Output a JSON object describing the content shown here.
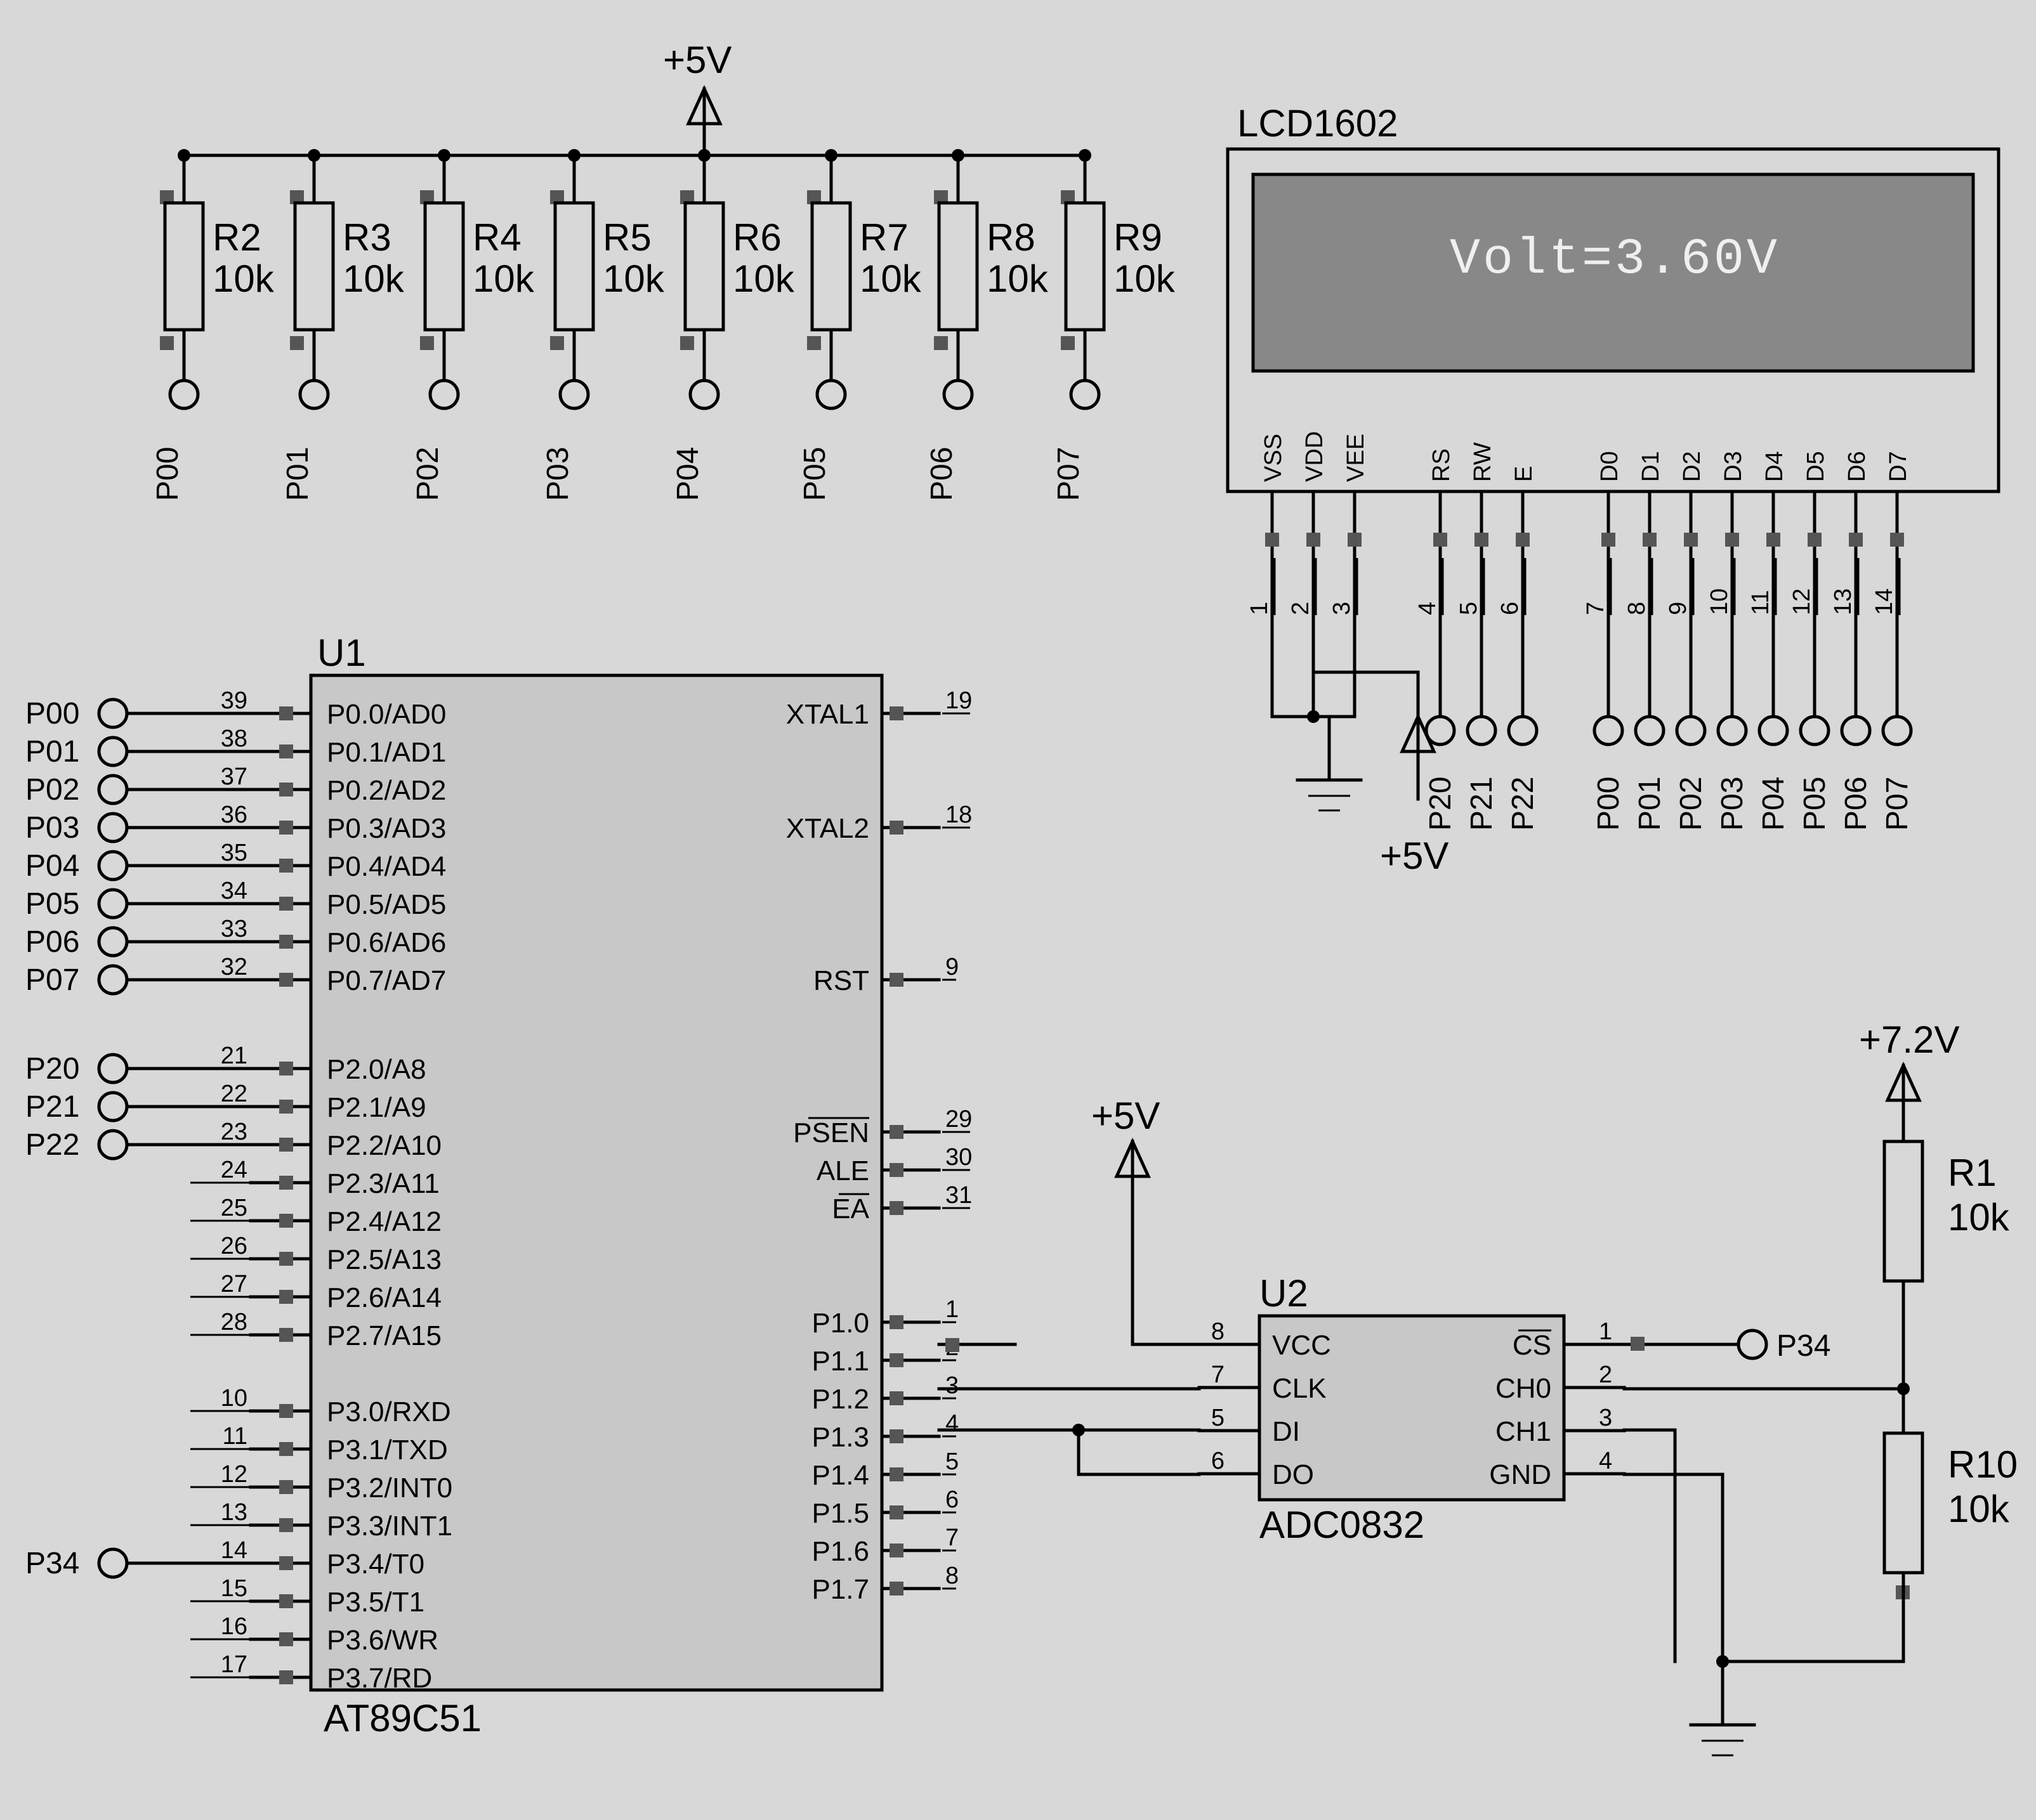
{
  "rails": {
    "v5": "+5V",
    "v72": "+7.2V"
  },
  "pullups": {
    "refs": [
      "R2",
      "R3",
      "R4",
      "R5",
      "R6",
      "R7",
      "R8",
      "R9"
    ],
    "value": "10k",
    "nets": [
      "P00",
      "P01",
      "P02",
      "P03",
      "P04",
      "P05",
      "P06",
      "P07"
    ]
  },
  "lcd": {
    "title": "LCD1602",
    "text": "Volt=3.60V",
    "pins_top": [
      "VSS",
      "VDD",
      "VEE",
      "RS",
      "RW",
      "E",
      "D0",
      "D1",
      "D2",
      "D3",
      "D4",
      "D5",
      "D6",
      "D7"
    ],
    "pins_num": [
      "1",
      "2",
      "3",
      "4",
      "5",
      "6",
      "7",
      "8",
      "9",
      "10",
      "11",
      "12",
      "13",
      "14"
    ],
    "nets": [
      "",
      "",
      "",
      "P20",
      "P21",
      "P22",
      "P00",
      "P01",
      "P02",
      "P03",
      "P04",
      "P05",
      "P06",
      "P07"
    ],
    "v5label": "+5V"
  },
  "u1": {
    "ref": "U1",
    "part": "AT89C51",
    "left": [
      {
        "num": "39",
        "name": "P0.0/AD0",
        "net": "P00"
      },
      {
        "num": "38",
        "name": "P0.1/AD1",
        "net": "P01"
      },
      {
        "num": "37",
        "name": "P0.2/AD2",
        "net": "P02"
      },
      {
        "num": "36",
        "name": "P0.3/AD3",
        "net": "P03"
      },
      {
        "num": "35",
        "name": "P0.4/AD4",
        "net": "P04"
      },
      {
        "num": "34",
        "name": "P0.5/AD5",
        "net": "P05"
      },
      {
        "num": "33",
        "name": "P0.6/AD6",
        "net": "P06"
      },
      {
        "num": "32",
        "name": "P0.7/AD7",
        "net": "P07"
      },
      {
        "num": "21",
        "name": "P2.0/A8",
        "net": "P20"
      },
      {
        "num": "22",
        "name": "P2.1/A9",
        "net": "P21"
      },
      {
        "num": "23",
        "name": "P2.2/A10",
        "net": "P22"
      },
      {
        "num": "24",
        "name": "P2.3/A11",
        "net": ""
      },
      {
        "num": "25",
        "name": "P2.4/A12",
        "net": ""
      },
      {
        "num": "26",
        "name": "P2.5/A13",
        "net": ""
      },
      {
        "num": "27",
        "name": "P2.6/A14",
        "net": ""
      },
      {
        "num": "28",
        "name": "P2.7/A15",
        "net": ""
      },
      {
        "num": "10",
        "name": "P3.0/RXD",
        "net": ""
      },
      {
        "num": "11",
        "name": "P3.1/TXD",
        "net": ""
      },
      {
        "num": "12",
        "name": "P3.2/INT0",
        "net": ""
      },
      {
        "num": "13",
        "name": "P3.3/INT1",
        "net": ""
      },
      {
        "num": "14",
        "name": "P3.4/T0",
        "net": "P34"
      },
      {
        "num": "15",
        "name": "P3.5/T1",
        "net": ""
      },
      {
        "num": "16",
        "name": "P3.6/WR",
        "net": ""
      },
      {
        "num": "17",
        "name": "P3.7/RD",
        "net": ""
      }
    ],
    "right": [
      {
        "num": "19",
        "name": "XTAL1",
        "row": 0
      },
      {
        "num": "18",
        "name": "XTAL2",
        "row": 3
      },
      {
        "num": "9",
        "name": "RST",
        "row": 7
      },
      {
        "num": "29",
        "name": "PSEN",
        "row": 11,
        "over": true
      },
      {
        "num": "30",
        "name": "ALE",
        "row": 12
      },
      {
        "num": "31",
        "name": "EA",
        "row": 13,
        "over": true
      },
      {
        "num": "1",
        "name": "P1.0",
        "row": 16
      },
      {
        "num": "2",
        "name": "P1.1",
        "row": 17
      },
      {
        "num": "3",
        "name": "P1.2",
        "row": 18
      },
      {
        "num": "4",
        "name": "P1.3",
        "row": 19
      },
      {
        "num": "5",
        "name": "P1.4",
        "row": 20
      },
      {
        "num": "6",
        "name": "P1.5",
        "row": 21
      },
      {
        "num": "7",
        "name": "P1.6",
        "row": 22
      },
      {
        "num": "8",
        "name": "P1.7",
        "row": 23
      }
    ]
  },
  "u2": {
    "ref": "U2",
    "part": "ADC0832",
    "left": [
      {
        "num": "8",
        "name": "VCC"
      },
      {
        "num": "7",
        "name": "CLK"
      },
      {
        "num": "5",
        "name": "DI"
      },
      {
        "num": "6",
        "name": "DO"
      }
    ],
    "right": [
      {
        "num": "1",
        "name": "CS",
        "over": true,
        "net": "P34"
      },
      {
        "num": "2",
        "name": "CH0"
      },
      {
        "num": "3",
        "name": "CH1"
      },
      {
        "num": "4",
        "name": "GND"
      }
    ]
  },
  "r1": {
    "ref": "R1",
    "value": "10k"
  },
  "r10": {
    "ref": "R10",
    "value": "10k"
  }
}
